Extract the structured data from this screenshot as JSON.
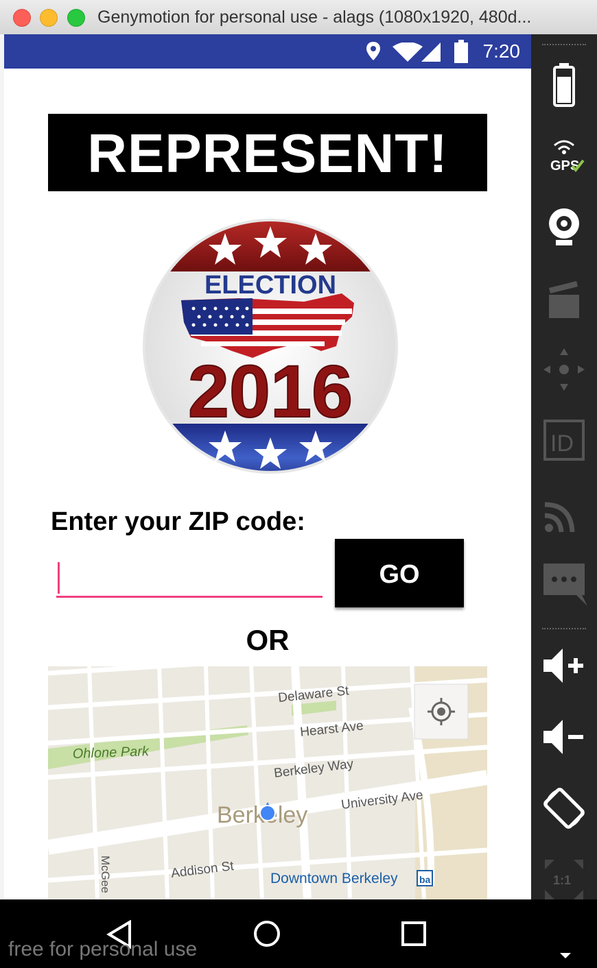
{
  "window": {
    "title": "Genymotion for personal use - alags (1080x1920, 480d..."
  },
  "status_bar": {
    "time": "7:20"
  },
  "app": {
    "banner_title": "REPRESENT!",
    "logo": {
      "top_text": "ELECTION",
      "year": "2016"
    },
    "zip_label": "Enter your ZIP code:",
    "zip_value": "",
    "go_label": "GO",
    "or_label": "OR",
    "map": {
      "labels": {
        "delaware": "Delaware St",
        "hearst": "Hearst Ave",
        "berkeley_way": "Berkeley Way",
        "university": "University Ave",
        "ohlone": "Ohlone Park",
        "city": "Berkeley",
        "addison": "Addison St",
        "downtown": "Downtown Berkeley",
        "mcgee": "McGee"
      }
    }
  },
  "watermark": "free for personal use",
  "sidebar": {
    "gps_label": "GPS",
    "id_label": "ID",
    "ratio_label": "1:1"
  },
  "colors": {
    "status_bar": "#2c3e9e",
    "accent_underline": "#f0407f",
    "sidebar_bg": "#262626"
  }
}
